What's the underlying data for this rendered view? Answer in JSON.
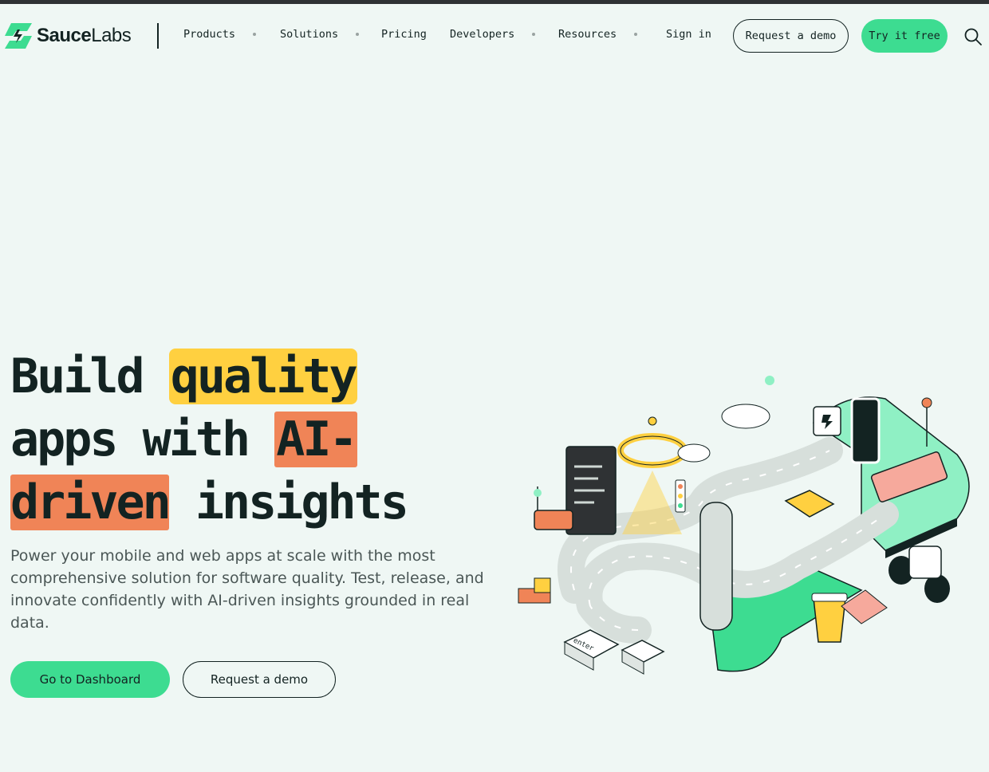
{
  "brand": {
    "name_bold": "Sauce",
    "name_light": "Labs",
    "accent": "#3ddc91"
  },
  "nav": {
    "items": [
      {
        "label": "Products",
        "has_dropdown": true
      },
      {
        "label": "Solutions",
        "has_dropdown": true
      },
      {
        "label": "Pricing",
        "has_dropdown": false
      },
      {
        "label": "Developers",
        "has_dropdown": true
      },
      {
        "label": "Resources",
        "has_dropdown": true
      }
    ],
    "sign_in": "Sign in",
    "request_demo": "Request a demo",
    "try_free": "Try it free",
    "search_icon": "search-icon"
  },
  "hero": {
    "line1_plain": "Build ",
    "line1_highlight": "quality",
    "line2_plain": "apps with ",
    "line2_highlight": "AI-",
    "line3_highlight": "driven",
    "line3_plain": " insights",
    "highlight_colors": {
      "yellow": "#ffd040",
      "orange": "#f08457"
    },
    "subtitle": "Power your mobile and web apps at scale with the most comprehensive solution for software quality. Test, release, and innovate confidently with AI-driven insights grounded in real data.",
    "primary_cta": "Go to Dashboard",
    "secondary_cta": "Request a demo"
  },
  "illustration": {
    "keycap_label": "enter"
  }
}
